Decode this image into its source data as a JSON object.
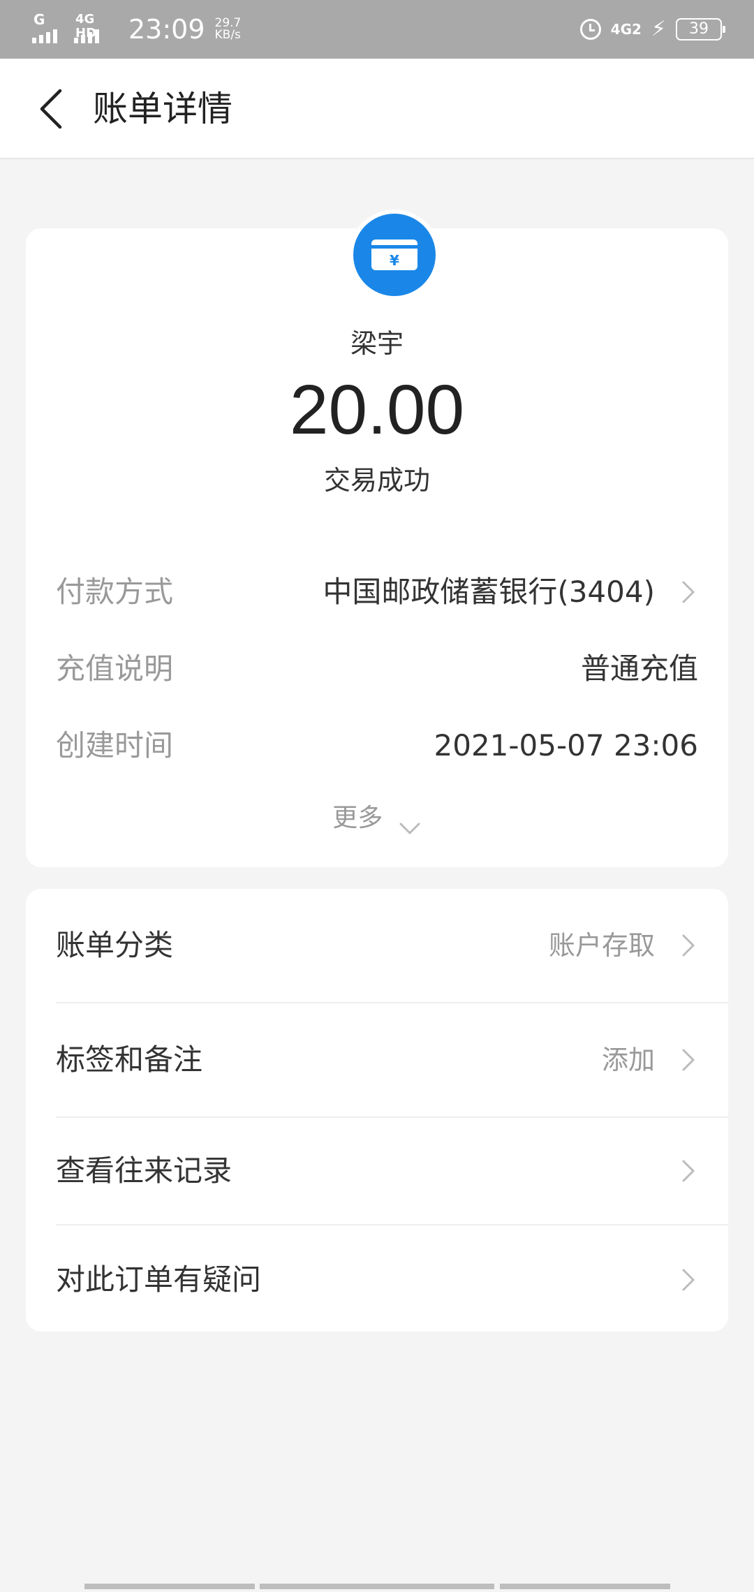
{
  "status_bar": {
    "sim1": "G",
    "sim2": "4G HD",
    "time": "23:09",
    "speed_value": "29.7",
    "speed_unit": "KB/s",
    "network": "4G2",
    "battery": "39",
    "icons": [
      "signal-icon",
      "alarm-icon",
      "charging-icon",
      "battery-icon"
    ]
  },
  "header": {
    "title": "账单详情",
    "back_icon": "chevron-left-icon"
  },
  "summary": {
    "avatar_icon": "card-yuan-icon",
    "avatar_color": "#1a87e8",
    "payee": "梁宇",
    "amount": "20.00",
    "status": "交易成功",
    "details": [
      {
        "label": "付款方式",
        "value": "中国邮政储蓄银行(3404)"
      },
      {
        "label": "充值说明",
        "value": "普通充值"
      },
      {
        "label": "创建时间",
        "value": "2021-05-07 23:06"
      }
    ],
    "more_label": "更多"
  },
  "actions": [
    {
      "label": "账单分类",
      "value": "账户存取"
    },
    {
      "label": "标签和备注",
      "value": "添加"
    },
    {
      "label": "查看往来记录",
      "value": ""
    },
    {
      "label": "对此订单有疑问",
      "value": ""
    }
  ]
}
